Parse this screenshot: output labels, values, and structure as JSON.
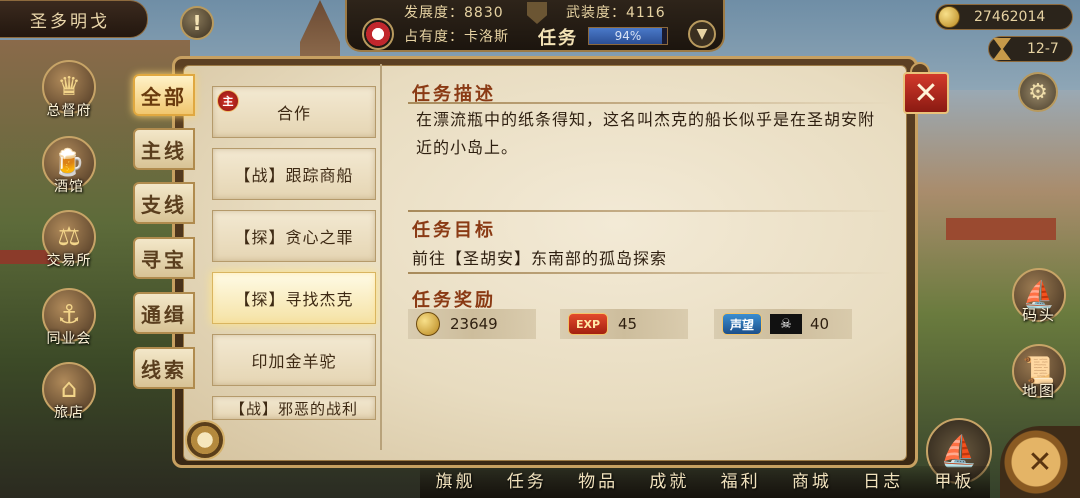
{
  "hud": {
    "city_name": "圣多明戈",
    "alert_glyph": "!",
    "development": "发展度：8830",
    "armament": "武装度：4116",
    "occupation": "占有度：卡洛斯",
    "quest_label": "任务",
    "quest_progress_text": "94%",
    "quest_progress_value": 0.94,
    "gold": "27462014",
    "date": "12-7"
  },
  "left_buttons": [
    {
      "label": "总督府",
      "icon": "crown-icon"
    },
    {
      "label": "酒馆",
      "icon": "beer-mug-icon"
    },
    {
      "label": "交易所",
      "icon": "scales-icon"
    },
    {
      "label": "同业会",
      "icon": "guild-icon"
    },
    {
      "label": "旅店",
      "icon": "inn-icon"
    }
  ],
  "right_buttons": [
    {
      "label": "码头",
      "icon": "dock-icon"
    },
    {
      "label": "地图",
      "icon": "map-scroll-icon"
    }
  ],
  "bottom_menu": [
    "旗舰",
    "任务",
    "物品",
    "成就",
    "福利",
    "商城",
    "日志",
    "甲板"
  ],
  "categories": [
    {
      "label": "全部",
      "active": true
    },
    {
      "label": "主线",
      "active": false
    },
    {
      "label": "支线",
      "active": false
    },
    {
      "label": "寻宝",
      "active": false
    },
    {
      "label": "通缉",
      "active": false
    },
    {
      "label": "线索",
      "active": false
    }
  ],
  "quests": [
    {
      "title": "合作",
      "badge": "主"
    },
    {
      "title": "【战】跟踪商船"
    },
    {
      "title": "【探】贪心之罪"
    },
    {
      "title": "【探】寻找杰克",
      "active": true
    },
    {
      "title": "印加金羊驼"
    },
    {
      "title": "【战】邪恶的战利"
    }
  ],
  "detail": {
    "desc_title": "任务描述",
    "description": "在漂流瓶中的纸条得知，这名叫杰克的船长似乎是在圣胡安附近的小岛上。",
    "target_title": "任务目标",
    "target": "前往【圣胡安】东南部的孤岛探索",
    "reward_title": "任务奖励",
    "rewards": {
      "gold": "23649",
      "exp_tag": "EXP",
      "exp": "45",
      "reputation_tag": "声望",
      "pirate_glyph": "☠",
      "reputation": "40"
    }
  },
  "close_glyph": "✕"
}
